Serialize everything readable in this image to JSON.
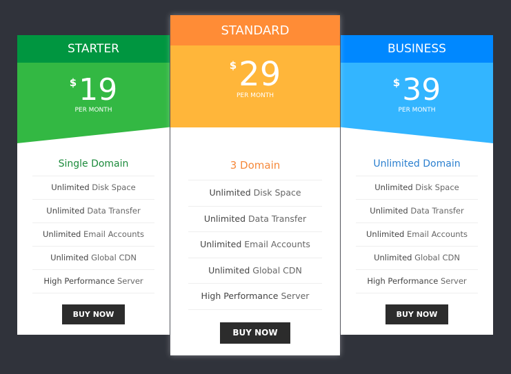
{
  "plans": [
    {
      "name": "STARTER",
      "currency": "$",
      "price": "19",
      "period": "PER MONTH",
      "domain": "Single Domain",
      "features": [
        [
          "Unlimited",
          " Disk Space"
        ],
        [
          "Unlimited",
          " Data Transfer"
        ],
        [
          "Unlimited",
          " Email Accounts"
        ],
        [
          "Unlimited",
          " Global CDN"
        ],
        [
          "High Performance",
          " Server"
        ]
      ],
      "button": "BUY NOW",
      "header_color": "#009640",
      "price_color": "#33b843",
      "domain_color": "#1a8a3a"
    },
    {
      "name": "STANDARD",
      "currency": "$",
      "price": "29",
      "period": "PER MONTH",
      "domain": "3 Domain",
      "features": [
        [
          "Unlimited",
          " Disk Space"
        ],
        [
          "Unlimited",
          " Data Transfer"
        ],
        [
          "Unlimited",
          " Email Accounts"
        ],
        [
          "Unlimited",
          " Global CDN"
        ],
        [
          "High Performance",
          " Server"
        ]
      ],
      "button": "BUY NOW",
      "header_color": "#ff8c36",
      "price_color": "#ffb63a",
      "domain_color": "#f5883a"
    },
    {
      "name": "BUSINESS",
      "currency": "$",
      "price": "39",
      "period": "PER MONTH",
      "domain": "Unlimited Domain",
      "features": [
        [
          "Unlimited",
          " Disk Space"
        ],
        [
          "Unlimited",
          " Data Transfer"
        ],
        [
          "Unlimited",
          " Email Accounts"
        ],
        [
          "Unlimited",
          " Global CDN"
        ],
        [
          "High Performance",
          " Server"
        ]
      ],
      "button": "BUY NOW",
      "header_color": "#0088ff",
      "price_color": "#33b5ff",
      "domain_color": "#2a7fcf"
    }
  ]
}
